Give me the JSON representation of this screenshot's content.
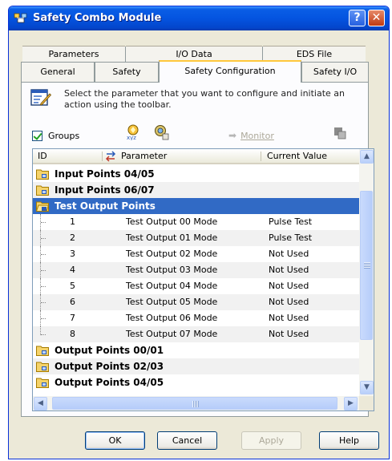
{
  "window": {
    "title": "Safety Combo Module",
    "help_button": "?",
    "close_button": "✕"
  },
  "tabs": {
    "row_back": [
      "Parameters",
      "I/O Data",
      "EDS File"
    ],
    "row_front": [
      "General",
      "Safety",
      "Safety Configuration",
      "Safety I/O"
    ],
    "active": "Safety Configuration"
  },
  "instructions": {
    "text": "Select the parameter that you want to configure and initiate an action using the toolbar."
  },
  "toolbar": {
    "groups_label": "Groups",
    "groups_checked": true,
    "monitor_label": "Monitor"
  },
  "list": {
    "columns": [
      "ID",
      "Parameter",
      "Current Value"
    ],
    "groups": [
      "Input Points 04/05",
      "Input Points 06/07",
      "Test Output Points",
      "Output Points 00/01",
      "Output Points 02/03",
      "Output Points 04/05"
    ],
    "selected_group": "Test Output Points",
    "rows": [
      {
        "id": "1",
        "parameter": "Test Output 00 Mode",
        "value": "Pulse Test"
      },
      {
        "id": "2",
        "parameter": "Test Output 01 Mode",
        "value": "Pulse Test"
      },
      {
        "id": "3",
        "parameter": "Test Output 02 Mode",
        "value": "Not Used"
      },
      {
        "id": "4",
        "parameter": "Test Output 03 Mode",
        "value": "Not Used"
      },
      {
        "id": "5",
        "parameter": "Test Output 04 Mode",
        "value": "Not Used"
      },
      {
        "id": "6",
        "parameter": "Test Output 05 Mode",
        "value": "Not Used"
      },
      {
        "id": "7",
        "parameter": "Test Output 06 Mode",
        "value": "Not Used"
      },
      {
        "id": "8",
        "parameter": "Test Output 07 Mode",
        "value": "Not Used"
      }
    ]
  },
  "buttons": {
    "ok": "OK",
    "cancel": "Cancel",
    "apply": "Apply",
    "help": "Help"
  },
  "colors": {
    "selection": "#316ac5",
    "title_bar": "#0454e0",
    "tab_highlight": "#ffc83c"
  }
}
